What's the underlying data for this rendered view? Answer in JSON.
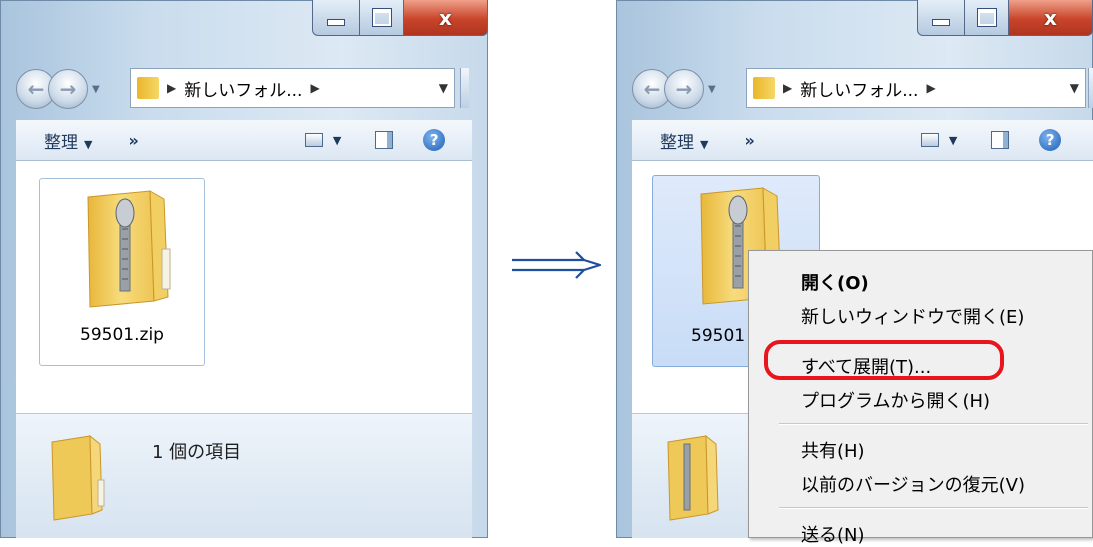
{
  "window": {
    "close_glyph": "x",
    "address_path": "新しいフォル...",
    "toolbar_organize": "整理",
    "toolbar_more": "»",
    "help_glyph": "?"
  },
  "left": {
    "file_name": "59501.zip",
    "status_text": "1 個の項目"
  },
  "right": {
    "file_name_partial": "59501"
  },
  "context_menu": {
    "items": [
      "開く(O)",
      "新しいウィンドウで開く(E)",
      "すべて展開(T)...",
      "プログラムから開く(H)",
      "共有(H)",
      "以前のバージョンの復元(V)",
      "送る(N)"
    ]
  },
  "colors": {
    "highlight": "#e8141e",
    "arrow": "#1d4f9c"
  }
}
